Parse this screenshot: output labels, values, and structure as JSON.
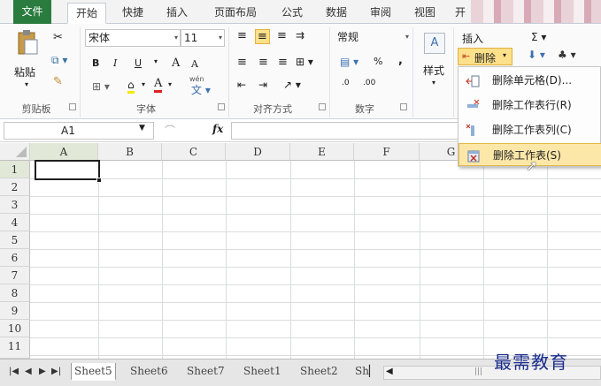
{
  "tabs": [
    {
      "label": "文件"
    },
    {
      "label": "开始"
    },
    {
      "label": "快捷"
    },
    {
      "label": "插入"
    },
    {
      "label": "页面布局"
    },
    {
      "label": "公式"
    },
    {
      "label": "数据"
    },
    {
      "label": "审阅"
    },
    {
      "label": "视图"
    },
    {
      "label": "开"
    }
  ],
  "ribbon": {
    "clipboard": {
      "paste": "粘贴",
      "label": "剪贴板"
    },
    "font": {
      "name": "宋体",
      "size": "11",
      "bold": "B",
      "italic": "I",
      "underline": "U",
      "grow": "A",
      "shrink": "A",
      "wen": "wén",
      "label": "字体"
    },
    "align": {
      "label": "对齐方式"
    },
    "number": {
      "format": "常规",
      "percent": "%",
      "comma": ",",
      "inc": ".0",
      "dec": ".00",
      "label": "数字"
    },
    "styles": {
      "label": "样式"
    },
    "cells": {
      "insert": "插入",
      "delete": "删除"
    }
  },
  "formula_bar": {
    "name_box": "A1",
    "fx": "fx",
    "formula": ""
  },
  "grid": {
    "columns": [
      "A",
      "B",
      "C",
      "D",
      "E",
      "F",
      "G"
    ],
    "rows": [
      "1",
      "2",
      "3",
      "4",
      "5",
      "6",
      "7",
      "8",
      "9",
      "10",
      "11"
    ]
  },
  "delete_menu": {
    "items": [
      {
        "label": "删除单元格(D)..."
      },
      {
        "label": "删除工作表行(R)"
      },
      {
        "label": "删除工作表列(C)"
      },
      {
        "label": "删除工作表(S)"
      }
    ]
  },
  "sheets": {
    "tabs": [
      "Sheet5",
      "Sheet6",
      "Sheet7",
      "Sheet1",
      "Sheet2",
      "Sh"
    ],
    "active": "Sheet5"
  },
  "watermark": "最需教育",
  "colors": {
    "file_tab": "#2a7b3e",
    "highlight": "#fce7a9",
    "grid_line": "#dadcdd"
  }
}
